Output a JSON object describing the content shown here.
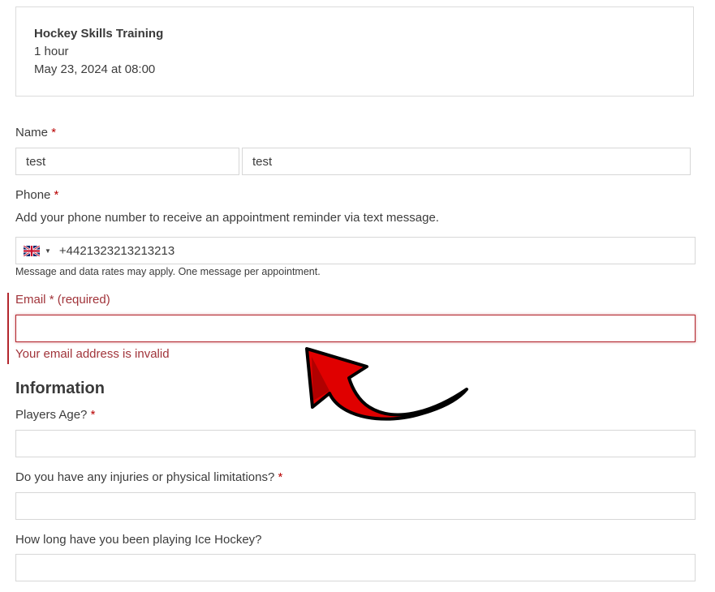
{
  "summary": {
    "title": "Hockey Skills Training",
    "duration": "1 hour",
    "datetime": "May 23, 2024 at 08:00"
  },
  "name": {
    "label": "Name",
    "required_mark": "*",
    "first_value": "test",
    "last_value": "test"
  },
  "phone": {
    "label": "Phone",
    "required_mark": "*",
    "description": "Add your phone number to receive an appointment reminder via text message.",
    "country_flag_icon": "uk-flag-icon",
    "value": "+4421323213213213",
    "note": "Message and data rates may apply. One message per appointment."
  },
  "email": {
    "label": "Email",
    "required_mark": "*",
    "required_text": "(required)",
    "value": "",
    "error": "Your email address is invalid"
  },
  "information": {
    "heading": "Information",
    "age_label": "Players Age?",
    "age_required_mark": "*",
    "injuries_label": "Do you have any injuries or physical limitations?",
    "injuries_required_mark": "*",
    "experience_label": "How long have you been playing Ice Hockey?"
  },
  "colors": {
    "error": "#b3262d",
    "required": "#b80000",
    "annotation_arrow": "#e00000"
  }
}
